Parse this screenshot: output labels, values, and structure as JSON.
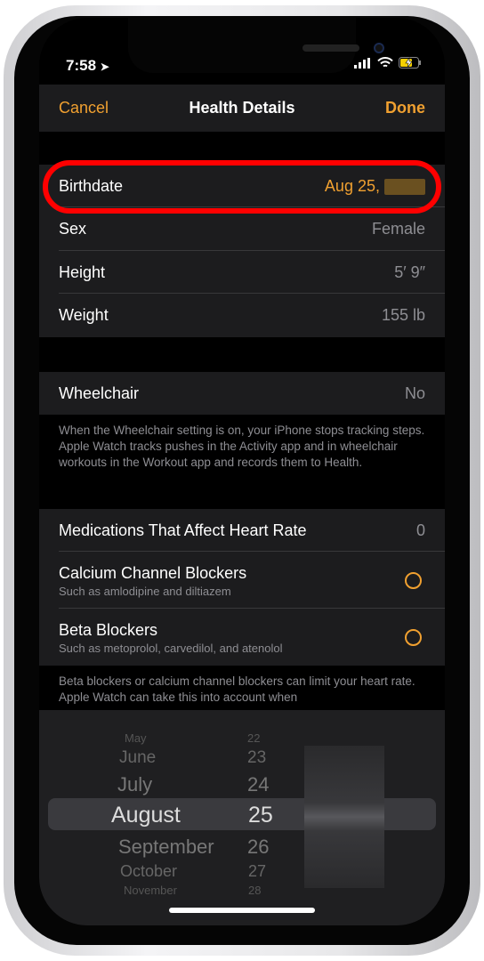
{
  "status": {
    "time": "7:58"
  },
  "nav": {
    "cancel": "Cancel",
    "title": "Health Details",
    "done": "Done"
  },
  "details": [
    {
      "label": "Birthdate",
      "value": "Aug 25,"
    },
    {
      "label": "Sex",
      "value": "Female"
    },
    {
      "label": "Height",
      "value": "5′ 9″"
    },
    {
      "label": "Weight",
      "value": "155 lb"
    }
  ],
  "wheelchair": {
    "label": "Wheelchair",
    "value": "No",
    "footer": "When the Wheelchair setting is on, your iPhone stops tracking steps. Apple Watch tracks pushes in the Activity app and in wheelchair workouts in the Workout app and records them to Health."
  },
  "medications": {
    "label": "Medications That Affect Heart Rate",
    "count": "0",
    "items": [
      {
        "label": "Calcium Channel Blockers",
        "sub": "Such as amlodipine and diltiazem"
      },
      {
        "label": "Beta Blockers",
        "sub": "Such as metoprolol, carvedilol, and atenolol"
      }
    ],
    "footer": "Beta blockers or calcium channel blockers can limit your heart rate. Apple Watch can take this into account when"
  },
  "picker": {
    "months": [
      "May",
      "June",
      "July",
      "August",
      "September",
      "October",
      "November"
    ],
    "days": [
      "22",
      "23",
      "24",
      "25",
      "26",
      "27",
      "28"
    ],
    "selected_month": "August",
    "selected_day": "25"
  },
  "colors": {
    "accent": "#f0a030",
    "highlight": "#ff0000"
  }
}
